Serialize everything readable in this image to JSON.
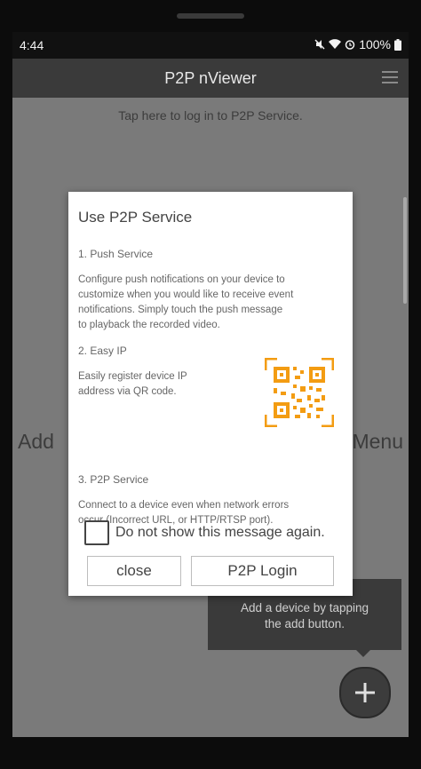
{
  "status_bar": {
    "time": "4:44",
    "battery": "100%"
  },
  "app_bar": {
    "title": "P2P nViewer"
  },
  "login_banner": "Tap here to log in to P2P Service.",
  "background": {
    "add_text": "Add",
    "menu_text": "Menu"
  },
  "dialog": {
    "title": "Use P2P Service",
    "sections": [
      {
        "heading": "1. Push Service",
        "lines": [
          "Configure push notifications on your device to",
          "customize when you would like to receive event",
          "notifications. Simply touch the push message",
          "to playback the recorded video."
        ]
      },
      {
        "heading": "2. Easy IP",
        "lines": [
          "Easily register device IP",
          "address via QR code."
        ]
      },
      {
        "heading": "3. P2P Service",
        "lines": [
          "Connect to a device even when network errors",
          "occur (Incorrect URL, or HTTP/RTSP port)."
        ]
      }
    ],
    "checkbox_label": "Do not show this message again.",
    "checkbox_checked": false,
    "close_label": "close",
    "login_label": "P2P Login",
    "qr_accent_color": "#f39c12"
  },
  "tooltip": {
    "lines": [
      "Add a device by tapping",
      "the add button."
    ]
  },
  "icons": {
    "menu": "hamburger-menu-icon",
    "add": "plus-icon",
    "qr": "qr-code-icon"
  }
}
